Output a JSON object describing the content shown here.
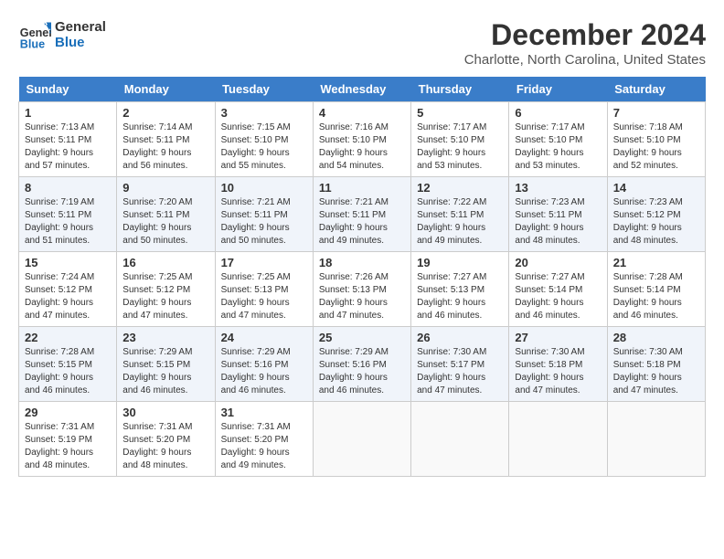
{
  "header": {
    "logo_line1": "General",
    "logo_line2": "Blue",
    "month": "December 2024",
    "location": "Charlotte, North Carolina, United States"
  },
  "weekdays": [
    "Sunday",
    "Monday",
    "Tuesday",
    "Wednesday",
    "Thursday",
    "Friday",
    "Saturday"
  ],
  "weeks": [
    [
      {
        "day": "1",
        "sunrise": "7:13 AM",
        "sunset": "5:11 PM",
        "daylight": "9 hours and 57 minutes."
      },
      {
        "day": "2",
        "sunrise": "7:14 AM",
        "sunset": "5:11 PM",
        "daylight": "9 hours and 56 minutes."
      },
      {
        "day": "3",
        "sunrise": "7:15 AM",
        "sunset": "5:10 PM",
        "daylight": "9 hours and 55 minutes."
      },
      {
        "day": "4",
        "sunrise": "7:16 AM",
        "sunset": "5:10 PM",
        "daylight": "9 hours and 54 minutes."
      },
      {
        "day": "5",
        "sunrise": "7:17 AM",
        "sunset": "5:10 PM",
        "daylight": "9 hours and 53 minutes."
      },
      {
        "day": "6",
        "sunrise": "7:17 AM",
        "sunset": "5:10 PM",
        "daylight": "9 hours and 53 minutes."
      },
      {
        "day": "7",
        "sunrise": "7:18 AM",
        "sunset": "5:10 PM",
        "daylight": "9 hours and 52 minutes."
      }
    ],
    [
      {
        "day": "8",
        "sunrise": "7:19 AM",
        "sunset": "5:11 PM",
        "daylight": "9 hours and 51 minutes."
      },
      {
        "day": "9",
        "sunrise": "7:20 AM",
        "sunset": "5:11 PM",
        "daylight": "9 hours and 50 minutes."
      },
      {
        "day": "10",
        "sunrise": "7:21 AM",
        "sunset": "5:11 PM",
        "daylight": "9 hours and 50 minutes."
      },
      {
        "day": "11",
        "sunrise": "7:21 AM",
        "sunset": "5:11 PM",
        "daylight": "9 hours and 49 minutes."
      },
      {
        "day": "12",
        "sunrise": "7:22 AM",
        "sunset": "5:11 PM",
        "daylight": "9 hours and 49 minutes."
      },
      {
        "day": "13",
        "sunrise": "7:23 AM",
        "sunset": "5:11 PM",
        "daylight": "9 hours and 48 minutes."
      },
      {
        "day": "14",
        "sunrise": "7:23 AM",
        "sunset": "5:12 PM",
        "daylight": "9 hours and 48 minutes."
      }
    ],
    [
      {
        "day": "15",
        "sunrise": "7:24 AM",
        "sunset": "5:12 PM",
        "daylight": "9 hours and 47 minutes."
      },
      {
        "day": "16",
        "sunrise": "7:25 AM",
        "sunset": "5:12 PM",
        "daylight": "9 hours and 47 minutes."
      },
      {
        "day": "17",
        "sunrise": "7:25 AM",
        "sunset": "5:13 PM",
        "daylight": "9 hours and 47 minutes."
      },
      {
        "day": "18",
        "sunrise": "7:26 AM",
        "sunset": "5:13 PM",
        "daylight": "9 hours and 47 minutes."
      },
      {
        "day": "19",
        "sunrise": "7:27 AM",
        "sunset": "5:13 PM",
        "daylight": "9 hours and 46 minutes."
      },
      {
        "day": "20",
        "sunrise": "7:27 AM",
        "sunset": "5:14 PM",
        "daylight": "9 hours and 46 minutes."
      },
      {
        "day": "21",
        "sunrise": "7:28 AM",
        "sunset": "5:14 PM",
        "daylight": "9 hours and 46 minutes."
      }
    ],
    [
      {
        "day": "22",
        "sunrise": "7:28 AM",
        "sunset": "5:15 PM",
        "daylight": "9 hours and 46 minutes."
      },
      {
        "day": "23",
        "sunrise": "7:29 AM",
        "sunset": "5:15 PM",
        "daylight": "9 hours and 46 minutes."
      },
      {
        "day": "24",
        "sunrise": "7:29 AM",
        "sunset": "5:16 PM",
        "daylight": "9 hours and 46 minutes."
      },
      {
        "day": "25",
        "sunrise": "7:29 AM",
        "sunset": "5:16 PM",
        "daylight": "9 hours and 46 minutes."
      },
      {
        "day": "26",
        "sunrise": "7:30 AM",
        "sunset": "5:17 PM",
        "daylight": "9 hours and 47 minutes."
      },
      {
        "day": "27",
        "sunrise": "7:30 AM",
        "sunset": "5:18 PM",
        "daylight": "9 hours and 47 minutes."
      },
      {
        "day": "28",
        "sunrise": "7:30 AM",
        "sunset": "5:18 PM",
        "daylight": "9 hours and 47 minutes."
      }
    ],
    [
      {
        "day": "29",
        "sunrise": "7:31 AM",
        "sunset": "5:19 PM",
        "daylight": "9 hours and 48 minutes."
      },
      {
        "day": "30",
        "sunrise": "7:31 AM",
        "sunset": "5:20 PM",
        "daylight": "9 hours and 48 minutes."
      },
      {
        "day": "31",
        "sunrise": "7:31 AM",
        "sunset": "5:20 PM",
        "daylight": "9 hours and 49 minutes."
      },
      null,
      null,
      null,
      null
    ]
  ]
}
